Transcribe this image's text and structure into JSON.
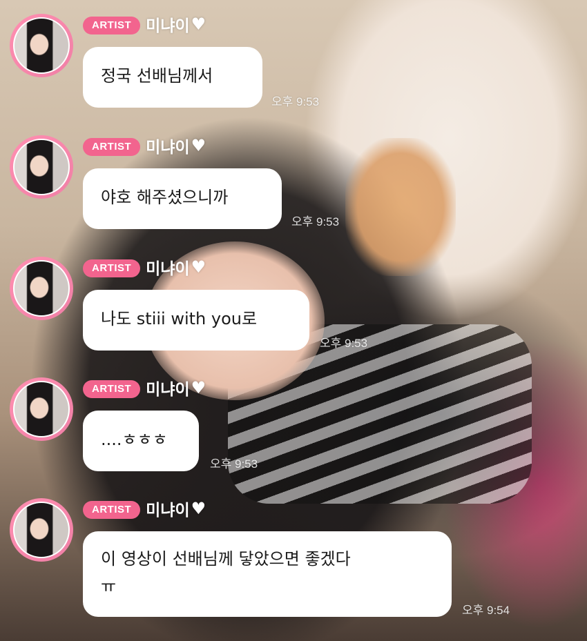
{
  "messages": [
    {
      "badge": "ARTIST",
      "sender": "미냐이",
      "text": "정국 선배님께서",
      "time": "오후 9:53"
    },
    {
      "badge": "ARTIST",
      "sender": "미냐이",
      "text": "야호 해주셨으니까",
      "time": "오후 9:53"
    },
    {
      "badge": "ARTIST",
      "sender": "미냐이",
      "text": "나도 stiii with you로",
      "time": "오후 9:53"
    },
    {
      "badge": "ARTIST",
      "sender": "미냐이",
      "text": "....ㅎㅎㅎ",
      "time": "오후 9:53"
    },
    {
      "badge": "ARTIST",
      "sender": "미냐이",
      "text": "이 영상이 선배님께 닿았으면 좋겠다",
      "text2": "ㅠ",
      "time": "오후 9:54"
    }
  ],
  "colors": {
    "badge": "#f2648e",
    "avatar_ring": "#f07fa6",
    "bubble": "#ffffff"
  },
  "icons": {
    "heart": "white-heart-icon"
  }
}
